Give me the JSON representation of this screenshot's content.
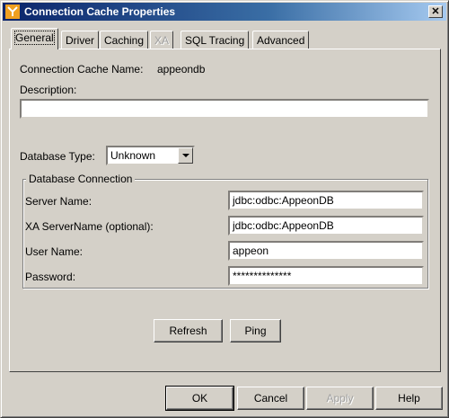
{
  "window": {
    "title": "Connection Cache Properties",
    "close_glyph": "✕"
  },
  "tabs": [
    {
      "label": "General",
      "active": true
    },
    {
      "label": "Driver"
    },
    {
      "label": "Caching"
    },
    {
      "label": "XA",
      "disabled": true
    },
    {
      "label": "SQL Tracing"
    },
    {
      "label": "Advanced"
    }
  ],
  "general": {
    "cache_name_label": "Connection Cache Name:",
    "cache_name_value": "appeondb",
    "description_label": "Description:",
    "description_value": "",
    "db_type_label": "Database Type:",
    "db_type_value": "Unknown"
  },
  "db_connection": {
    "group_title": "Database Connection",
    "server_label": "Server Name:",
    "server_value": "jdbc:odbc:AppeonDB",
    "xa_server_label": "XA ServerName (optional):",
    "xa_server_value": "jdbc:odbc:AppeonDB",
    "user_label": "User Name:",
    "user_value": "appeon",
    "password_label": "Password:",
    "password_value": "**************"
  },
  "actions": {
    "refresh": "Refresh",
    "ping": "Ping"
  },
  "footer": {
    "ok": "OK",
    "cancel": "Cancel",
    "apply": "Apply",
    "help": "Help"
  },
  "colors": {
    "face": "#d4d0c8",
    "titlebar_start": "#0a246a",
    "titlebar_end": "#a6caf0"
  },
  "icons": {
    "app": "sybase-logo-icon",
    "close": "close-icon",
    "dropdown": "chevron-down-icon"
  }
}
